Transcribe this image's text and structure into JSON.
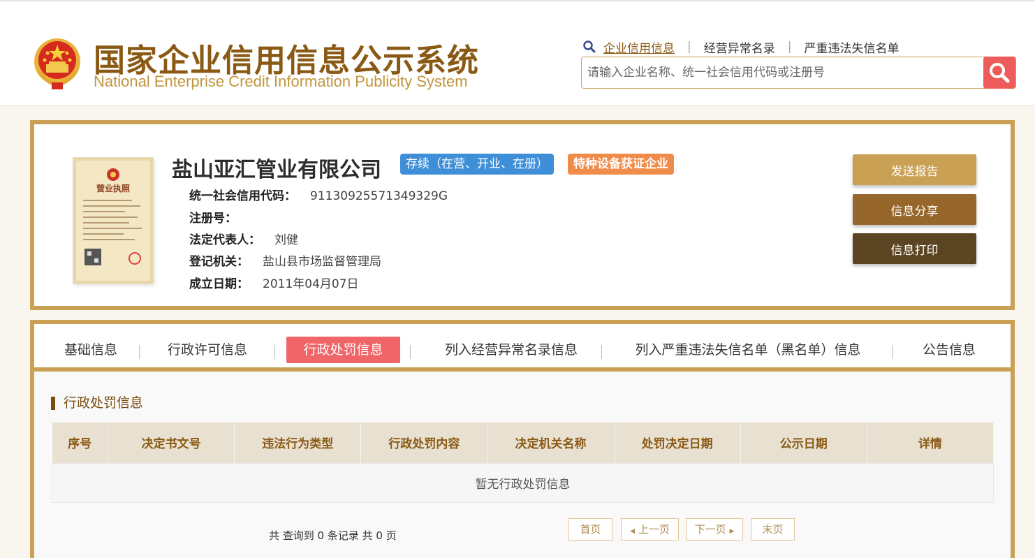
{
  "header": {
    "title_cn": "国家企业信用信息公示系统",
    "title_en": "National Enterprise Credit Information Publicity System",
    "nav": [
      "企业信用信息",
      "经营异常名录",
      "严重违法失信名单"
    ],
    "nav_separator": "|",
    "search_placeholder": "请输入企业名称、统一社会信用代码或注册号"
  },
  "company": {
    "name": "盐山亚汇管业有限公司",
    "status_badge": "存续（在营、开业、在册）",
    "special_badge": "特种设备获证企业",
    "license_title": "营业执照",
    "fields": [
      {
        "label": "统一社会信用代码：",
        "value": "91130925571349329G"
      },
      {
        "label": "注册号：",
        "value": ""
      },
      {
        "label": "法定代表人：",
        "value": "刘健"
      },
      {
        "label": "登记机关：",
        "value": "盐山县市场监督管理局"
      },
      {
        "label": "成立日期：",
        "value": "2011年04月07日"
      }
    ],
    "actions": {
      "send": "发送报告",
      "share": "信息分享",
      "print": "信息打印"
    }
  },
  "tabs": [
    "基础信息",
    "行政许可信息",
    "行政处罚信息",
    "列入经营异常名录信息",
    "列入严重违法失信名单（黑名单）信息",
    "公告信息"
  ],
  "active_tab": "行政处罚信息",
  "section": {
    "title": "行政处罚信息",
    "columns": [
      "序号",
      "决定书文号",
      "违法行为类型",
      "行政处罚内容",
      "决定机关名称",
      "处罚决定日期",
      "公示日期",
      "详情"
    ],
    "empty_text": "暂无行政处罚信息"
  },
  "pagination": {
    "summary": "共 查询到 0 条记录 共 0 页",
    "first": "首页",
    "prev": "上一页",
    "next": "下一页",
    "last": "末页"
  },
  "colors": {
    "gold": "#c9a054",
    "brown": "#97662a",
    "dark_brown": "#5b4421",
    "active_tab": "#f06668",
    "search_button": "#ee5b5b",
    "status_badge": "#3f8fd8",
    "special_badge": "#ef8c4a"
  }
}
